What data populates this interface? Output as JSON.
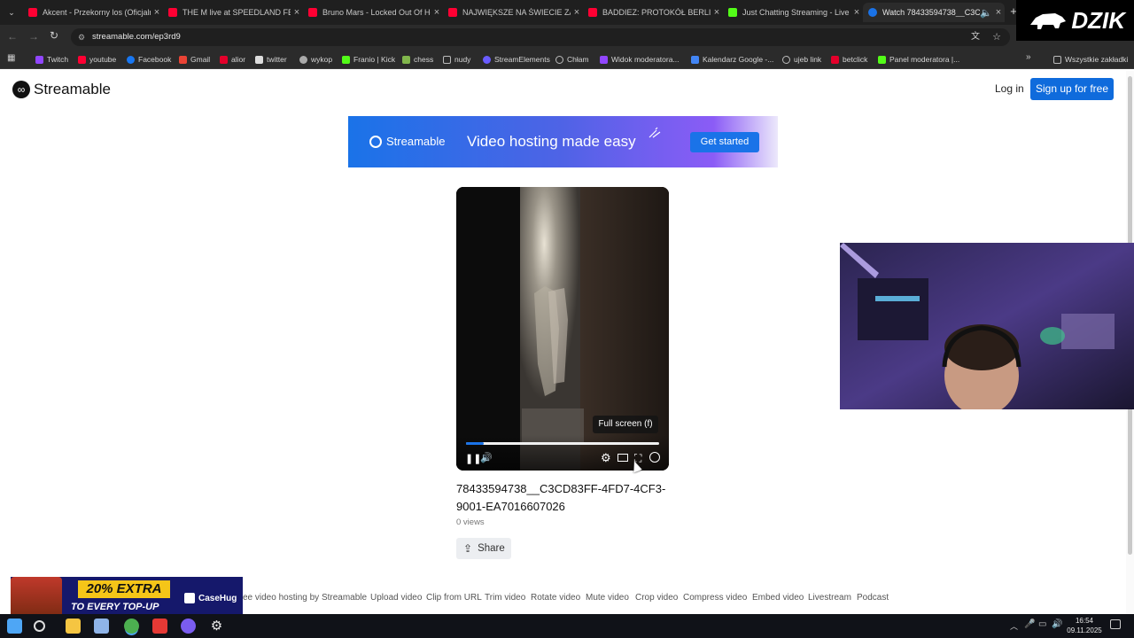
{
  "browser": {
    "tabs": [
      {
        "title": "Akcent - Przekorny los (Oficjalny",
        "icon": "youtube-icon"
      },
      {
        "title": "THE M live at SPEEDLAND FEST",
        "icon": "youtube-icon"
      },
      {
        "title": "Bruno Mars - Locked Out Of Heaven",
        "icon": "youtube-icon"
      },
      {
        "title": "NAJWIĘKSZE NA ŚWIECIE ZAW",
        "icon": "youtube-icon"
      },
      {
        "title": "BADDIEZ: PROTOKÓŁ BERLIN -",
        "icon": "youtube-icon"
      },
      {
        "title": "Just Chatting Streaming - Live",
        "icon": "kick-icon"
      },
      {
        "title": "Watch 78433594738__C3C",
        "icon": "streamable-icon",
        "active": true
      }
    ],
    "url": "streamable.com/ep3rd9",
    "bookmarks": [
      {
        "label": "Twitch",
        "color": "#9146ff"
      },
      {
        "label": "youtube",
        "color": "#ff0033"
      },
      {
        "label": "Facebook",
        "color": "#1877f2"
      },
      {
        "label": "Gmail",
        "color": "#ea4335"
      },
      {
        "label": "alior",
        "color": "#e4002b"
      },
      {
        "label": "twitter",
        "color": "#dddddd"
      },
      {
        "label": "wykop",
        "color": "#aaaaaa"
      },
      {
        "label": "Franio | Kick",
        "color": "#53fc18"
      },
      {
        "label": "chess",
        "color": "#81b64c"
      },
      {
        "label": "nudy",
        "color": "#bbbbbb"
      },
      {
        "label": "StreamElements",
        "color": "#6a5cff"
      },
      {
        "label": "Chłam",
        "color": "#bbbbbb"
      },
      {
        "label": "Widok moderatora...",
        "color": "#9146ff"
      },
      {
        "label": "Kalendarz Google -...",
        "color": "#4285f4"
      },
      {
        "label": "ujeb link",
        "color": "#bbbbbb"
      },
      {
        "label": "betclick",
        "color": "#e4002b"
      },
      {
        "label": "Panel moderatora |...",
        "color": "#53fc18"
      }
    ],
    "all_bookmarks": "Wszystkie zakładki"
  },
  "overlay": {
    "brand": "DZIK",
    "ad_headline": "20% EXTRA",
    "ad_sub": "TO EVERY TOP-UP",
    "ad_brand": "CaseHug"
  },
  "header": {
    "logo": "Streamable",
    "login": "Log in",
    "signup": "Sign up for free"
  },
  "banner": {
    "logo": "Streamable",
    "tagline": "Video hosting made easy",
    "cta": "Get started"
  },
  "player": {
    "progress": 0.09,
    "tooltip": "Full screen (f)"
  },
  "video": {
    "title": "78433594738__C3CD83FF-4FD7-4CF3-9001-EA7016607026",
    "views": "0 views",
    "share": "Share"
  },
  "footer": {
    "links": [
      "ee video hosting by Streamable",
      "Upload video",
      "Clip from URL",
      "Trim video",
      "Rotate video",
      "Mute video",
      "Crop video",
      "Compress video",
      "Embed video",
      "Livestream",
      "Podcast"
    ]
  },
  "taskbar": {
    "time": "16:54",
    "date": "09.11.2025"
  }
}
